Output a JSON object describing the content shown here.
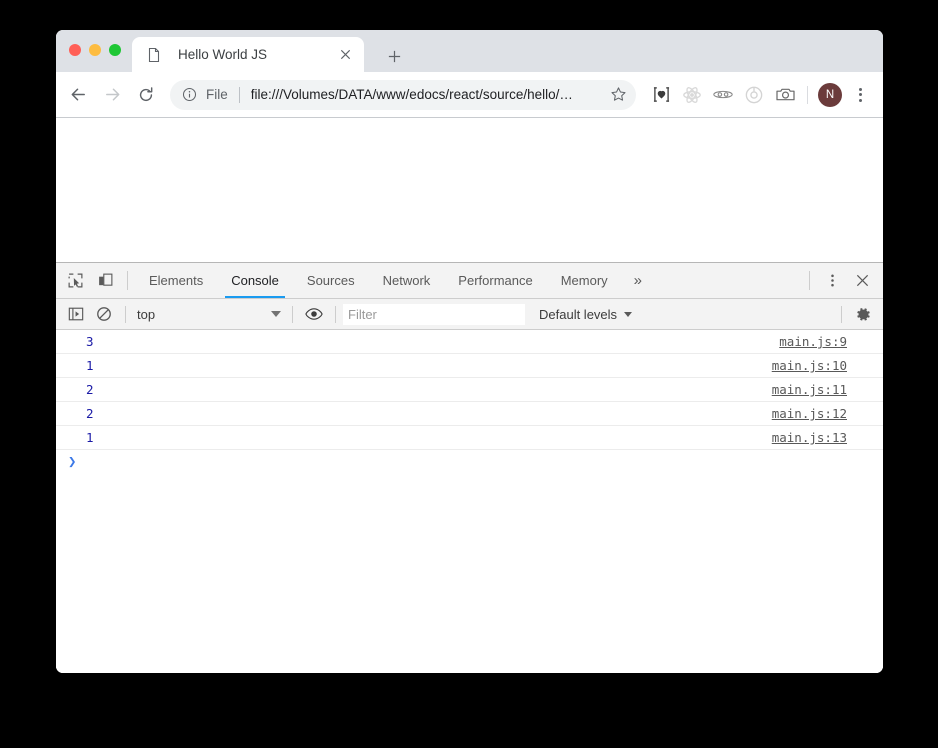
{
  "window": {
    "traffic_lights": [
      {
        "name": "close",
        "color": "#ff5f57"
      },
      {
        "name": "minimize",
        "color": "#fdbc40"
      },
      {
        "name": "maximize",
        "color": "#1ec735"
      }
    ]
  },
  "tabstrip": {
    "tab": {
      "favicon": "page-icon",
      "title": "Hello World JS",
      "close_icon": "close-icon"
    },
    "new_tab_icon": "plus-icon"
  },
  "omnibar": {
    "back_icon": "back-arrow-icon",
    "forward_icon": "forward-arrow-icon",
    "reload_icon": "reload-icon",
    "info_icon": "info-circle-icon",
    "url_scheme": "File",
    "url": "file:///Volumes/DATA/www/edocs/react/source/hello/…",
    "star_icon": "star-outline-icon",
    "extensions": [
      {
        "name": "heart-brackets-icon",
        "glyph": "]♥[",
        "enabled": true
      },
      {
        "name": "react-devtools-icon",
        "glyph": "react",
        "enabled": false
      },
      {
        "name": "goggles-icon",
        "glyph": "(oo)",
        "enabled": true
      },
      {
        "name": "target-circle-icon",
        "glyph": "target",
        "enabled": false
      },
      {
        "name": "camera-icon",
        "glyph": "camera",
        "enabled": true
      }
    ],
    "avatar_initial": "N",
    "avatar_color": "#6b3b3b",
    "menu_icon": "three-dots-vertical-icon"
  },
  "devtools": {
    "inspect_icon": "inspect-element-icon",
    "device_toolbar_icon": "device-toolbar-icon",
    "tabs": [
      {
        "label": "Elements",
        "active": false
      },
      {
        "label": "Console",
        "active": true
      },
      {
        "label": "Sources",
        "active": false
      },
      {
        "label": "Network",
        "active": false
      },
      {
        "label": "Performance",
        "active": false
      },
      {
        "label": "Memory",
        "active": false
      }
    ],
    "overflow_label": "»",
    "active_tab_underline_color": "#1a9bf0",
    "more_options_icon": "three-dots-vertical-icon",
    "close_icon": "close-icon",
    "toolbar": {
      "sidebar_toggle_icon": "console-sidebar-icon",
      "clear_console_icon": "clear-console-icon",
      "context": "top",
      "context_caret_icon": "chevron-down-icon",
      "live_expression_icon": "eye-icon",
      "filter_placeholder": "Filter",
      "filter_value": "",
      "levels_label": "Default levels",
      "levels_caret_icon": "chevron-down-icon",
      "settings_icon": "gear-icon"
    },
    "log_rows": [
      {
        "value": "3",
        "source": "main.js:9"
      },
      {
        "value": "1",
        "source": "main.js:10"
      },
      {
        "value": "2",
        "source": "main.js:11"
      },
      {
        "value": "2",
        "source": "main.js:12"
      },
      {
        "value": "1",
        "source": "main.js:13"
      }
    ],
    "prompt_caret": "❯",
    "log_value_color": "#1a1aa6",
    "log_source_color": "#585858"
  }
}
